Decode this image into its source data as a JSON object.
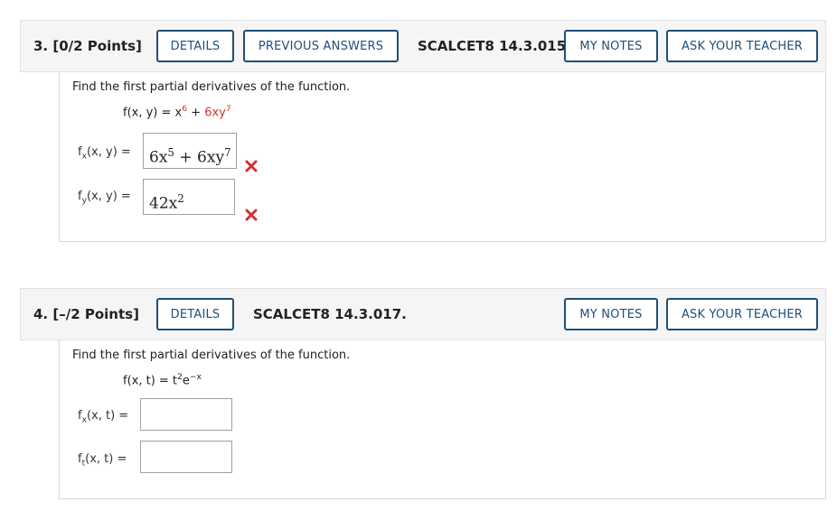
{
  "q3": {
    "title": "3.  [0/2 Points]",
    "details": "DETAILS",
    "previous_answers": "PREVIOUS ANSWERS",
    "code": "SCALCET8 14.3.015.",
    "my_notes": "MY NOTES",
    "ask_teacher": "ASK YOUR TEACHER",
    "prompt": "Find the first partial derivatives of the function.",
    "function": {
      "lhs": "f(x, y) = x",
      "exp1": "6",
      "plus": " + ",
      "term2": "6xy",
      "exp2": "7"
    },
    "fx": {
      "f": "f",
      "sub": "x",
      "args": "(x, y)  =",
      "answer_base1": "6x",
      "answer_exp1": "5",
      "answer_mid": " + 6xy",
      "answer_exp2": "7"
    },
    "fy": {
      "f": "f",
      "sub": "y",
      "args": "(x, y)  =",
      "answer_base": "42x",
      "answer_exp": "2"
    },
    "status_color": "#d0312d"
  },
  "q4": {
    "title": "4.  [–/2 Points]",
    "details": "DETAILS",
    "code": "SCALCET8 14.3.017.",
    "my_notes": "MY NOTES",
    "ask_teacher": "ASK YOUR TEACHER",
    "prompt": "Find the first partial derivatives of the function.",
    "function": {
      "lhs": "f(x, t) = t",
      "exp1": "2",
      "mid": "e",
      "exp2": "−x"
    },
    "fx": {
      "f": "f",
      "sub": "x",
      "args": "(x, t)  =",
      "value": ""
    },
    "ft": {
      "f": "f",
      "sub": "t",
      "args": "(x, t)  =",
      "value": ""
    }
  },
  "colors": {
    "accent": "#1f4e79",
    "incorrect": "#d0312d"
  }
}
